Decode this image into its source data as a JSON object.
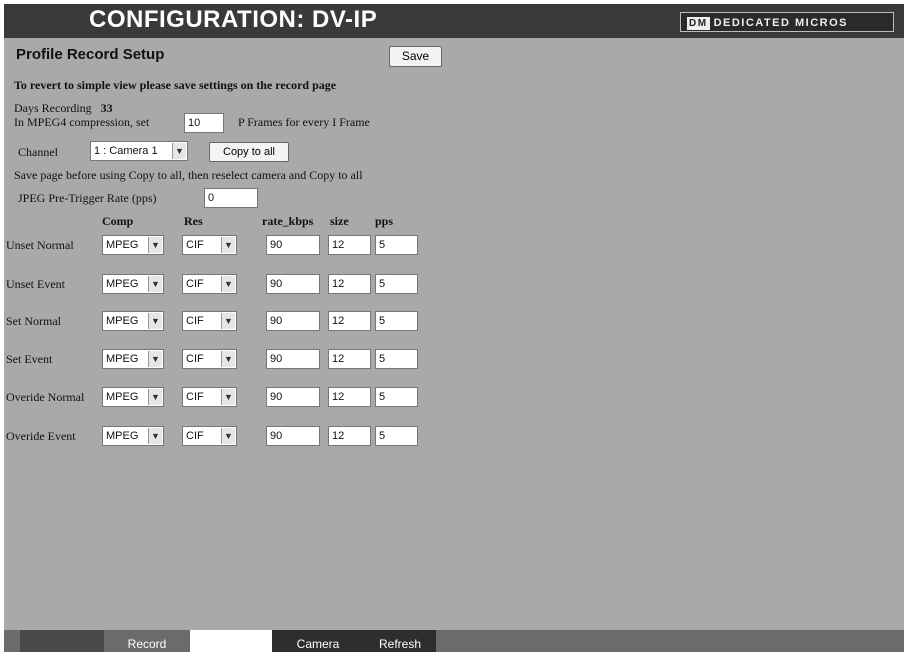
{
  "header": {
    "title": "CONFIGURATION: DV-IP",
    "logo_mark": "DM",
    "logo_text": "DEDICATED MICROS"
  },
  "page": {
    "heading": "Profile Record Setup",
    "save_label": "Save",
    "revert_note": "To revert to simple view please save settings on the record page",
    "days_recording_label": "Days Recording",
    "days_recording_value": "33",
    "mpeg_prefix": "In MPEG4 compression, set",
    "mpeg_value": "10",
    "mpeg_suffix": "P Frames for every I Frame",
    "channel_label": "Channel",
    "channel_value": "1 : Camera 1",
    "copy_label": "Copy to all",
    "copy_note": "Save page before using Copy to all, then reselect camera and Copy to all",
    "jpeg_label": "JPEG Pre-Trigger Rate (pps)",
    "jpeg_value": "0"
  },
  "table": {
    "headers": {
      "comp": "Comp",
      "res": "Res",
      "rate": "rate_kbps",
      "size": "size",
      "pps": "pps"
    },
    "rows": [
      {
        "label": "Unset Normal",
        "comp": "MPEG",
        "res": "CIF",
        "rate": "90",
        "size": "12",
        "pps": "5"
      },
      {
        "label": "Unset Event",
        "comp": "MPEG",
        "res": "CIF",
        "rate": "90",
        "size": "12",
        "pps": "5"
      },
      {
        "label": "Set Normal",
        "comp": "MPEG",
        "res": "CIF",
        "rate": "90",
        "size": "12",
        "pps": "5"
      },
      {
        "label": "Set Event",
        "comp": "MPEG",
        "res": "CIF",
        "rate": "90",
        "size": "12",
        "pps": "5"
      },
      {
        "label": "Overide Normal",
        "comp": "MPEG",
        "res": "CIF",
        "rate": "90",
        "size": "12",
        "pps": "5"
      },
      {
        "label": "Overide Event",
        "comp": "MPEG",
        "res": "CIF",
        "rate": "90",
        "size": "12",
        "pps": "5"
      }
    ]
  },
  "footer": {
    "tabs": [
      {
        "label": ""
      },
      {
        "label": "Record"
      },
      {
        "label": ""
      },
      {
        "label": "Camera"
      },
      {
        "label": "Refresh"
      }
    ]
  },
  "icons": {
    "dropdown": "chevron-down-icon"
  },
  "colors": {
    "titlebar": "#3a3a3a",
    "panel": "#a9a9a9",
    "footer": "#6b6b6b"
  }
}
